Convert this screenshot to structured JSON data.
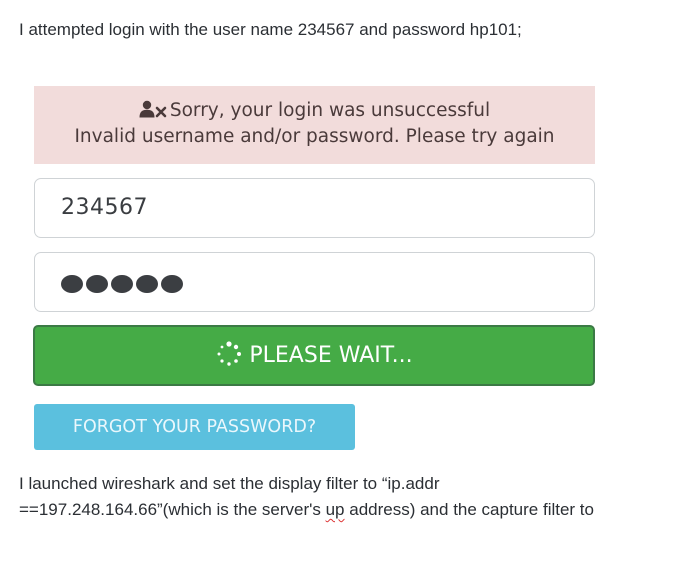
{
  "intro_text": "I attempted login with the user name 234567 and password hp101;",
  "alert": {
    "line1": "Sorry, your login was unsuccessful",
    "line2": "Invalid username and/or password. Please try again",
    "icon": "user-times-icon",
    "background_color": "#f2dcdb"
  },
  "form": {
    "username_value": "234567",
    "password_masked_length": 5,
    "submit_label": "PLEASE WAIT...",
    "submit_icon": "spinner-icon",
    "submit_color": "#45ab46",
    "forgot_label": "FORGOT YOUR PASSWORD?",
    "forgot_color": "#5bc0de"
  },
  "outro": {
    "line1": "I launched wireshark and set the display filter to “ip.addr",
    "line2_before": "==197.248.164.66”(which is the server's ",
    "line2_misspelled": "up",
    "line2_after": " address) and the capture filter to"
  }
}
